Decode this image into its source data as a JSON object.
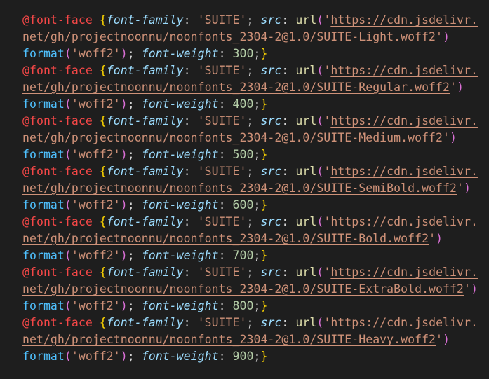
{
  "editor": {
    "language": "css",
    "blocks": [
      {
        "at_rule": "@font-face",
        "prop_family": "font-family",
        "family_value": "'SUITE'",
        "prop_src": "src",
        "url_func": "url",
        "url_open": "('",
        "url_part1": "https://cdn.jsdelivr.",
        "url_part2": "net/gh/projectnoonnu/noonfonts_2304-2@1.0/SUITE-Light.woff2",
        "url_close": "')",
        "format_func": "format",
        "format_value": "'woff2'",
        "prop_weight": "font-weight",
        "weight_value": "300"
      },
      {
        "at_rule": "@font-face",
        "prop_family": "font-family",
        "family_value": "'SUITE'",
        "prop_src": "src",
        "url_func": "url",
        "url_open": "('",
        "url_part1": "https://cdn.jsdelivr.",
        "url_part2": "net/gh/projectnoonnu/noonfonts_2304-2@1.0/SUITE-Regular.woff2",
        "url_close": "')",
        "format_func": "format",
        "format_value": "'woff2'",
        "prop_weight": "font-weight",
        "weight_value": "400"
      },
      {
        "at_rule": "@font-face",
        "prop_family": "font-family",
        "family_value": "'SUITE'",
        "prop_src": "src",
        "url_func": "url",
        "url_open": "('",
        "url_part1": "https://cdn.jsdelivr.",
        "url_part2": "net/gh/projectnoonnu/noonfonts_2304-2@1.0/SUITE-Medium.woff2",
        "url_close": "')",
        "format_func": "format",
        "format_value": "'woff2'",
        "prop_weight": "font-weight",
        "weight_value": "500"
      },
      {
        "at_rule": "@font-face",
        "prop_family": "font-family",
        "family_value": "'SUITE'",
        "prop_src": "src",
        "url_func": "url",
        "url_open": "('",
        "url_part1": "https://cdn.jsdelivr.",
        "url_part2": "net/gh/projectnoonnu/noonfonts_2304-2@1.0/SUITE-SemiBold.woff2",
        "url_close": "')",
        "format_func": "format",
        "format_value": "'woff2'",
        "prop_weight": "font-weight",
        "weight_value": "600"
      },
      {
        "at_rule": "@font-face",
        "prop_family": "font-family",
        "family_value": "'SUITE'",
        "prop_src": "src",
        "url_func": "url",
        "url_open": "('",
        "url_part1": "https://cdn.jsdelivr.",
        "url_part2": "net/gh/projectnoonnu/noonfonts_2304-2@1.0/SUITE-Bold.woff2",
        "url_close": "')",
        "format_func": "format",
        "format_value": "'woff2'",
        "prop_weight": "font-weight",
        "weight_value": "700"
      },
      {
        "at_rule": "@font-face",
        "prop_family": "font-family",
        "family_value": "'SUITE'",
        "prop_src": "src",
        "url_func": "url",
        "url_open": "('",
        "url_part1": "https://cdn.jsdelivr.",
        "url_part2": "net/gh/projectnoonnu/noonfonts_2304-2@1.0/SUITE-ExtraBold.woff2",
        "url_close": "')",
        "format_func": "format",
        "format_value": "'woff2'",
        "prop_weight": "font-weight",
        "weight_value": "800"
      },
      {
        "at_rule": "@font-face",
        "prop_family": "font-family",
        "family_value": "'SUITE'",
        "prop_src": "src",
        "url_func": "url",
        "url_open": "('",
        "url_part1": "https://cdn.jsdelivr.",
        "url_part2": "net/gh/projectnoonnu/noonfonts_2304-2@1.0/SUITE-Heavy.woff2",
        "url_close": "')",
        "format_func": "format",
        "format_value": "'woff2'",
        "prop_weight": "font-weight",
        "weight_value": "900"
      }
    ]
  },
  "theme": {
    "background": "#1e1e1e",
    "at_rule_color": "#f44747",
    "brace_color": "#ffd700",
    "property_color": "#9cdcfe",
    "string_color": "#ce9178",
    "function_color": "#dcdcaa",
    "paren_color": "#da70d6",
    "number_color": "#b5cea8"
  }
}
